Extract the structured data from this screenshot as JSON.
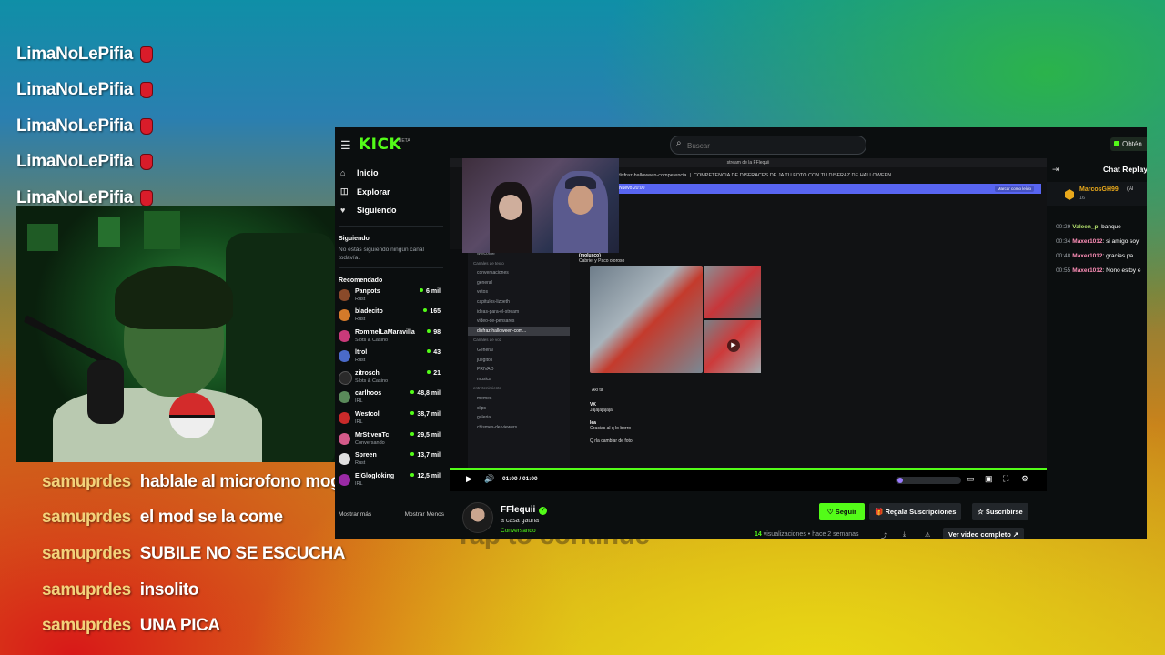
{
  "overlay": {
    "top_names": [
      "LimaNoLePifia",
      "LimaNoLePifia",
      "LimaNoLePifia",
      "LimaNoLePifia",
      "LimaNoLePifia"
    ],
    "chat": [
      {
        "user": "samuprdes",
        "msg": "hablale al microfono mogoli"
      },
      {
        "user": "samuprdes",
        "msg": "el mod se la come"
      },
      {
        "user": "samuprdes",
        "msg": "SUBILE NO SE ESCUCHA"
      },
      {
        "user": "samuprdes",
        "msg": "insolito"
      },
      {
        "user": "samuprdes",
        "msg": "UNA PICA"
      }
    ],
    "tap_ghost": "Tap to continue"
  },
  "kick": {
    "logo": "KICK",
    "beta": "BETA",
    "search_placeholder": "Buscar",
    "obten": "Obtén",
    "nav": [
      {
        "label": "Inicio",
        "icon": "⌂"
      },
      {
        "label": "Explorar",
        "icon": "◫"
      },
      {
        "label": "Siguiendo",
        "icon": "♥"
      }
    ],
    "following_heading": "Siguiendo",
    "following_note": "No estás siguiendo ningún canal todavía.",
    "recommended_heading": "Recomendado",
    "recommended": [
      {
        "name": "Panpots",
        "category": "Rust",
        "viewers": "6 mil",
        "color": "#8a4a2a"
      },
      {
        "name": "bladecito",
        "category": "Rust",
        "viewers": "165",
        "color": "#d47a2a"
      },
      {
        "name": "RommelLaMaravilla",
        "category": "Slots & Casino",
        "viewers": "98",
        "color": "#c93a7a"
      },
      {
        "name": "ltrol",
        "category": "Rust",
        "viewers": "43",
        "color": "#4a6ac9"
      },
      {
        "name": "zitrosch",
        "category": "Slots & Casino",
        "viewers": "21",
        "color": "#2a2a2a"
      },
      {
        "name": "carlhoos",
        "category": "IRL",
        "viewers": "48,8 mil",
        "color": "#5a8a5a"
      },
      {
        "name": "Westcol",
        "category": "IRL",
        "viewers": "38,7 mil",
        "color": "#c92a2a"
      },
      {
        "name": "MrStivenTc",
        "category": "Conversando",
        "viewers": "29,5 mil",
        "color": "#d45a8a"
      },
      {
        "name": "Spreen",
        "category": "Rust",
        "viewers": "13,7 mil",
        "color": "#e0e0e0"
      },
      {
        "name": "ElGlogloking",
        "category": "IRL",
        "viewers": "12,5 mil",
        "color": "#9a2aa5"
      }
    ],
    "show_more": "Mostrar más",
    "show_less": "Mostrar Menos",
    "player": {
      "time": "01:00 / 01:00",
      "discord_title": "stream de la FFlequii",
      "discord_channel": "disfraz-halloween-competencia",
      "discord_topic": "COMPETENCIA DE DISFRACES DE JA TU FOTO CON TU DISFRAZ DE HALLOWEEN",
      "discord_banner_btn": "Marcar como leído",
      "discord_banner_text": "Nuevo 20:00",
      "discord_channels": [
        {
          "label": "welcome",
          "type": "ch"
        },
        {
          "label": "Canales de texto",
          "type": "head"
        },
        {
          "label": "conversaciones",
          "type": "ch"
        },
        {
          "label": "general",
          "type": "ch"
        },
        {
          "label": "vetos",
          "type": "ch"
        },
        {
          "label": "capitulos-lizbeth",
          "type": "ch"
        },
        {
          "label": "ideas-para-el-stream",
          "type": "ch"
        },
        {
          "label": "video-de-pensares",
          "type": "ch"
        },
        {
          "label": "disfraz-halloween-com...",
          "type": "active"
        },
        {
          "label": "Canales de voz",
          "type": "head"
        },
        {
          "label": "General",
          "type": "ch"
        },
        {
          "label": "juegitos",
          "type": "ch"
        },
        {
          "label": "PRIVAO",
          "type": "ch"
        },
        {
          "label": "musica",
          "type": "ch"
        },
        {
          "label": "entretenimiento",
          "type": "head"
        },
        {
          "label": "memes",
          "type": "ch"
        },
        {
          "label": "clips",
          "type": "ch"
        },
        {
          "label": "galeria",
          "type": "ch"
        },
        {
          "label": "chismes-de-viewers",
          "type": "ch"
        }
      ],
      "discord_msgs": [
        {
          "user": "(molusco)",
          "text": "Cabriel y Paco oloroso"
        },
        {
          "user": "VK",
          "text": "Jajajajajaja"
        },
        {
          "user": "lea",
          "text": "Gracias al q lo borro"
        },
        {
          "user": "",
          "text": "Q rla cambiar de foto"
        },
        {
          "user": "",
          "text": "Aki ta"
        }
      ]
    },
    "chat_replay": {
      "title": "Chat Replay",
      "pinned_user": "MarcosGH99",
      "pinned_sub": "16",
      "pinned_extra": "(Al",
      "messages": [
        {
          "time": "00:29",
          "user": "Valeen_p",
          "text": "banque",
          "style": "green"
        },
        {
          "time": "00:34",
          "user": "Maxer1012",
          "text": "si amigo soy",
          "style": "pink"
        },
        {
          "time": "00:48",
          "user": "Maxer1012",
          "text": "gracias pa",
          "style": "pink"
        },
        {
          "time": "00:55",
          "user": "Maxer1012",
          "text": "Nono estoy e",
          "style": "pink"
        }
      ]
    },
    "channel": {
      "name": "FFlequii",
      "stream_title": "a casa gauna",
      "category": "Conversando",
      "follow": "Seguir",
      "gift": "Regala Suscripciones",
      "subscribe": "Suscribirse",
      "views_count": "14",
      "views_label": "visualizaciones",
      "ago": "hace 2 semanas",
      "full_video": "Ver video completo"
    }
  }
}
